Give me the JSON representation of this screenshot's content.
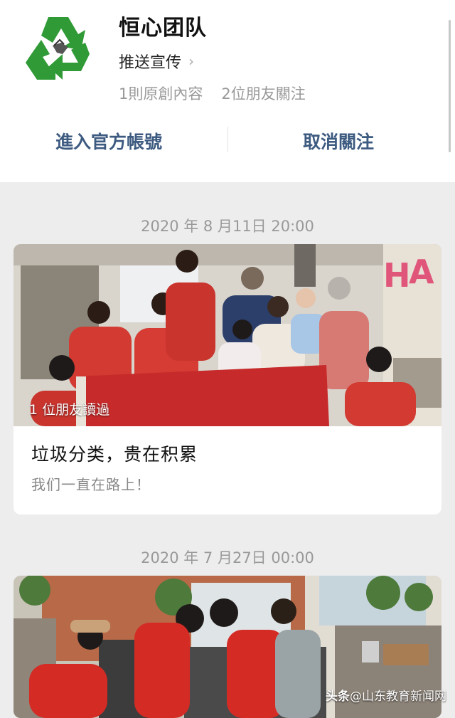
{
  "account": {
    "name": "恒心团队",
    "push_label": "推送宣传",
    "original_count": "1則原創內容",
    "friends_following": "2位朋友關注",
    "logo_icon": "recycle-icon",
    "brand_color": "#3a9b3a"
  },
  "actions": {
    "enter_official": "進入官方帳號",
    "unfollow": "取消關注",
    "accent_color": "#3d5a80"
  },
  "feed": [
    {
      "date": "2020 年 8 月11日 20:00",
      "read_badge": "1 位朋友讀過",
      "title": "垃圾分类，贵在积累",
      "digest": "我们一直在路上！"
    },
    {
      "date": "2020 年 7 月27日 00:00"
    }
  ],
  "watermark": {
    "brand": "头条",
    "handle": "@山东教育新闻网"
  }
}
